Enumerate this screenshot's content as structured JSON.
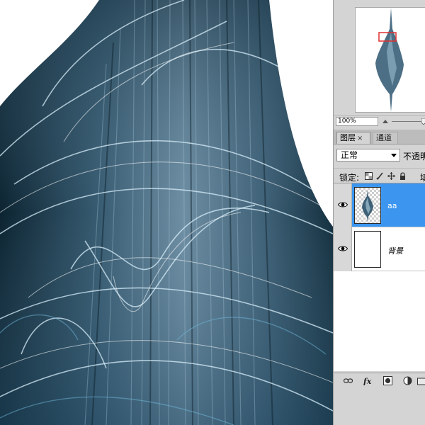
{
  "navigator": {
    "zoom": "100%"
  },
  "layers_panel": {
    "tabs": [
      {
        "label": "图层",
        "close": "×",
        "active": true
      },
      {
        "label": "通道",
        "active": false
      }
    ],
    "blend_mode": "正常",
    "opacity_label": "不透明",
    "lock_label": "锁定:",
    "fill_label": "填",
    "layers": [
      {
        "name": "aa",
        "selected": true,
        "visible": true
      },
      {
        "name": "背景",
        "selected": false,
        "visible": true
      }
    ]
  },
  "colors": {
    "selected_layer": "#3c96f0",
    "panel_bg": "#d4d4d4",
    "nav_view_box": "#e03030"
  },
  "icons": [
    "eye-icon",
    "lock-transparency-icon",
    "lock-image-icon",
    "lock-position-icon",
    "lock-all-icon",
    "link-icon",
    "fx-icon",
    "add-mask-icon",
    "adjustment-layer-icon",
    "new-group-icon",
    "zoom-out-icon"
  ]
}
